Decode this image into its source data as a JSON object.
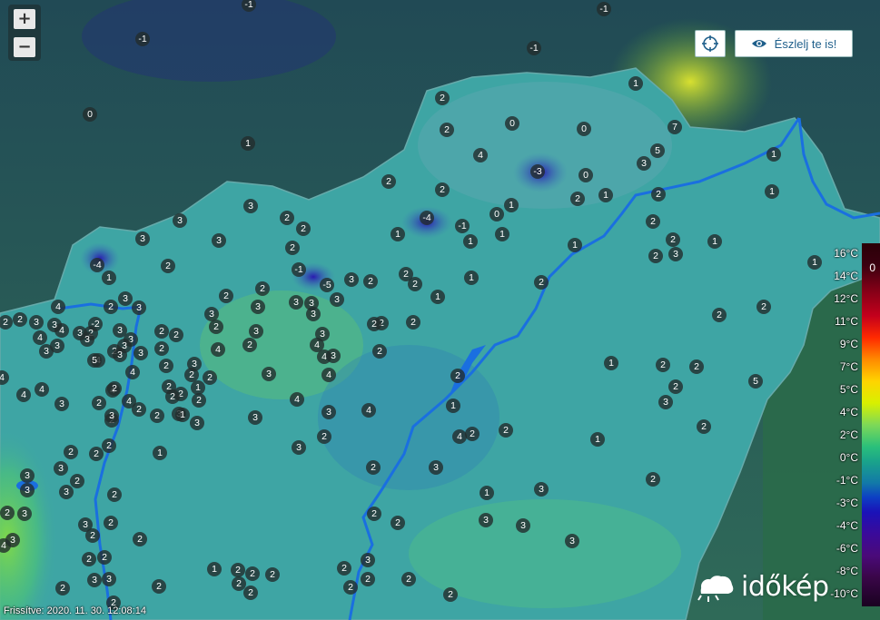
{
  "controls": {
    "zoom_in": "+",
    "zoom_out": "−",
    "observe_label": "Észlelj te is!"
  },
  "brand": {
    "name": "időkép"
  },
  "status": {
    "updated": "Frissítve: 2020. 11. 30. 12:08:14"
  },
  "legend": {
    "top_value": "0",
    "labels": [
      "16°C",
      "14°C",
      "12°C",
      "11°C",
      "9°C",
      "7°C",
      "5°C",
      "4°C",
      "2°C",
      "0°C",
      "-1°C",
      "-3°C",
      "-4°C",
      "-6°C",
      "-8°C",
      "-10°C"
    ]
  },
  "colors": {
    "land_base": "#3ea5a4",
    "outside_area": "#2f5a4a",
    "rivers": "#1a6fe0",
    "brand_text": "#ffffff"
  },
  "stations": [
    {
      "v": "-1"
    },
    {
      "v": "-1"
    },
    {
      "v": "-1"
    },
    {
      "v": "-1"
    },
    {
      "v": "0"
    },
    {
      "v": "1"
    },
    {
      "v": "1"
    },
    {
      "v": "7"
    },
    {
      "v": "5"
    },
    {
      "v": "3"
    },
    {
      "v": "2"
    },
    {
      "v": "0"
    },
    {
      "v": "2"
    },
    {
      "v": "0"
    },
    {
      "v": "4"
    },
    {
      "v": "-3"
    },
    {
      "v": "0"
    },
    {
      "v": "1"
    },
    {
      "v": "1"
    },
    {
      "v": "1"
    },
    {
      "v": "1"
    },
    {
      "v": "0"
    },
    {
      "v": "2"
    },
    {
      "v": "2"
    },
    {
      "v": "2"
    },
    {
      "v": "2"
    },
    {
      "v": "1"
    },
    {
      "v": "-4"
    },
    {
      "v": "-1"
    },
    {
      "v": "1"
    },
    {
      "v": "1"
    },
    {
      "v": "1"
    },
    {
      "v": "2"
    },
    {
      "v": "2"
    },
    {
      "v": "1"
    },
    {
      "v": "2"
    },
    {
      "v": "3"
    },
    {
      "v": "3"
    },
    {
      "v": "3"
    },
    {
      "v": "2"
    },
    {
      "v": "-4"
    },
    {
      "v": "1"
    },
    {
      "v": "-1"
    },
    {
      "v": "-5"
    },
    {
      "v": "2"
    },
    {
      "v": "2"
    },
    {
      "v": "3"
    },
    {
      "v": "3"
    },
    {
      "v": "2"
    },
    {
      "v": "1"
    },
    {
      "v": "2"
    },
    {
      "v": "1"
    },
    {
      "v": "2"
    },
    {
      "v": "1"
    },
    {
      "v": "2"
    },
    {
      "v": "2"
    },
    {
      "v": "2"
    },
    {
      "v": "2"
    },
    {
      "v": "2"
    },
    {
      "v": "2"
    },
    {
      "v": "3"
    },
    {
      "v": "3"
    },
    {
      "v": "2"
    },
    {
      "v": "3"
    },
    {
      "v": "3"
    },
    {
      "v": "2"
    },
    {
      "v": "3"
    },
    {
      "v": "3"
    },
    {
      "v": "2"
    },
    {
      "v": "2"
    },
    {
      "v": "4"
    },
    {
      "v": "3"
    },
    {
      "v": "2"
    },
    {
      "v": "-2"
    },
    {
      "v": "3"
    },
    {
      "v": "3"
    },
    {
      "v": "4"
    },
    {
      "v": "3"
    },
    {
      "v": "2"
    },
    {
      "v": "3"
    },
    {
      "v": "4"
    },
    {
      "v": "3"
    },
    {
      "v": "3"
    },
    {
      "v": "2"
    },
    {
      "v": "2"
    },
    {
      "v": "3"
    },
    {
      "v": "3"
    },
    {
      "v": "3"
    },
    {
      "v": "3"
    },
    {
      "v": "3"
    },
    {
      "v": "3"
    },
    {
      "v": "2"
    },
    {
      "v": "2"
    },
    {
      "v": "4"
    },
    {
      "v": "4"
    },
    {
      "v": "3"
    },
    {
      "v": "2"
    },
    {
      "v": "3"
    },
    {
      "v": "4"
    },
    {
      "v": "2"
    },
    {
      "v": "4"
    },
    {
      "v": "2"
    },
    {
      "v": "4"
    },
    {
      "v": "5"
    },
    {
      "v": "4"
    },
    {
      "v": "2"
    },
    {
      "v": "1"
    },
    {
      "v": "2"
    },
    {
      "v": "3"
    },
    {
      "v": "2"
    },
    {
      "v": "2"
    },
    {
      "v": "2"
    },
    {
      "v": "2"
    },
    {
      "v": "3"
    },
    {
      "v": "1"
    },
    {
      "v": "2"
    },
    {
      "v": "2"
    },
    {
      "v": "2"
    },
    {
      "v": "1"
    },
    {
      "v": "2"
    },
    {
      "v": "2"
    },
    {
      "v": "3"
    },
    {
      "v": "4"
    },
    {
      "v": "3"
    },
    {
      "v": "3"
    },
    {
      "v": "4"
    },
    {
      "v": "4"
    },
    {
      "v": "4"
    },
    {
      "v": "3"
    },
    {
      "v": "2"
    },
    {
      "v": "3"
    },
    {
      "v": "2"
    },
    {
      "v": "2"
    },
    {
      "v": "1"
    },
    {
      "v": "4"
    },
    {
      "v": "3"
    },
    {
      "v": "4"
    },
    {
      "v": "3"
    },
    {
      "v": "3"
    },
    {
      "v": "2"
    },
    {
      "v": "2"
    },
    {
      "v": "3"
    },
    {
      "v": "2"
    },
    {
      "v": "2"
    },
    {
      "v": "1"
    },
    {
      "v": "1"
    },
    {
      "v": "2"
    },
    {
      "v": "2"
    },
    {
      "v": "2"
    },
    {
      "v": "3"
    },
    {
      "v": "2"
    },
    {
      "v": "5"
    },
    {
      "v": "4"
    },
    {
      "v": "4"
    },
    {
      "v": "3"
    },
    {
      "v": "3"
    },
    {
      "v": "2"
    },
    {
      "v": "2"
    },
    {
      "v": "3"
    },
    {
      "v": "2"
    },
    {
      "v": "2"
    },
    {
      "v": "3"
    },
    {
      "v": "2"
    },
    {
      "v": "3"
    },
    {
      "v": "3"
    },
    {
      "v": "2"
    },
    {
      "v": "3"
    },
    {
      "v": "2"
    },
    {
      "v": "2"
    },
    {
      "v": "2"
    },
    {
      "v": "2"
    },
    {
      "v": "2"
    },
    {
      "v": "3"
    },
    {
      "v": "4"
    },
    {
      "v": "3"
    },
    {
      "v": "3"
    },
    {
      "v": "2"
    },
    {
      "v": "2"
    },
    {
      "v": "2"
    },
    {
      "v": "1"
    },
    {
      "v": "2"
    },
    {
      "v": "2"
    },
    {
      "v": "2"
    },
    {
      "v": "2"
    },
    {
      "v": "2"
    },
    {
      "v": "2"
    },
    {
      "v": "3"
    },
    {
      "v": "2"
    },
    {
      "v": "2"
    },
    {
      "v": "2"
    },
    {
      "v": "2"
    },
    {
      "v": "1"
    },
    {
      "v": "3"
    },
    {
      "v": "2"
    },
    {
      "v": "2"
    },
    {
      "v": "3"
    },
    {
      "v": "3"
    },
    {
      "v": "3"
    },
    {
      "v": "2"
    }
  ]
}
